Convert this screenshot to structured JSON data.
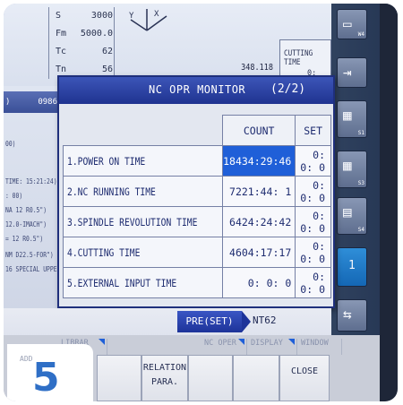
{
  "background": {
    "params": [
      {
        "key": "S",
        "value": "3000"
      },
      {
        "key": "Fm",
        "value": "5000.0"
      },
      {
        "key": "Tc",
        "value": "62"
      },
      {
        "key": "Tn",
        "value": "56"
      }
    ],
    "position_value": "348.118",
    "cutting_label": "CUTTING TIME",
    "cutting_value": "0: 0:27",
    "left_panel": {
      "header_left": ")",
      "header_right": "0986",
      "lines": [
        "00)",
        "",
        "TIME: 15:21:24)",
        ": 00)",
        "NA 12  R0.5\")",
        "12.0-IMACH\")",
        "= 12  R0.5\")",
        "NM  D22.5-FOR\")",
        "16 SPECIAL UPPER R"
      ]
    }
  },
  "modal": {
    "title": "NC OPR MONITOR",
    "page": "(2/2)",
    "columns": {
      "count": "COUNT",
      "set": "SET"
    },
    "rows": [
      {
        "label": "1.POWER ON TIME",
        "count": "18434:29:46",
        "set": "0: 0: 0",
        "selected": true
      },
      {
        "label": "2.NC RUNNING TIME",
        "count": "7221:44: 1",
        "set": "0: 0: 0",
        "selected": false
      },
      {
        "label": "3.SPINDLE REVOLUTION TIME",
        "count": "6424:24:42",
        "set": "0: 0: 0",
        "selected": false
      },
      {
        "label": "4.CUTTING TIME",
        "count": "4604:17:17",
        "set": "0: 0: 0",
        "selected": false
      },
      {
        "label": "5.EXTERNAL INPUT TIME",
        "count": "0: 0: 0",
        "set": "0: 0: 0",
        "selected": false
      }
    ]
  },
  "status": {
    "mode": "PRE(SET)",
    "nt": "NT62"
  },
  "softkeys": {
    "faded": [
      "LIBRAR",
      "NC OPER",
      "DISPLAY",
      "WINDOW"
    ],
    "relation": "RELATION\nPARA.",
    "close": "CLOSE"
  },
  "toolbar": [
    {
      "tag": "W4",
      "icon": "monitor-icon"
    },
    {
      "tag": "",
      "icon": "logout-icon"
    },
    {
      "tag": "S1",
      "icon": "grid-icon"
    },
    {
      "tag": "S3",
      "icon": "grid-icon"
    },
    {
      "tag": "S4",
      "icon": "calculator-icon"
    },
    {
      "tag": "1",
      "icon": "page-icon"
    },
    {
      "tag": "",
      "icon": "swap-icon"
    }
  ],
  "step": {
    "add_label": "ADD",
    "number": "5"
  },
  "colors": {
    "accent": "#1f5fd8",
    "title_bar": "#1f3390",
    "badge": "#2f6fc6"
  }
}
